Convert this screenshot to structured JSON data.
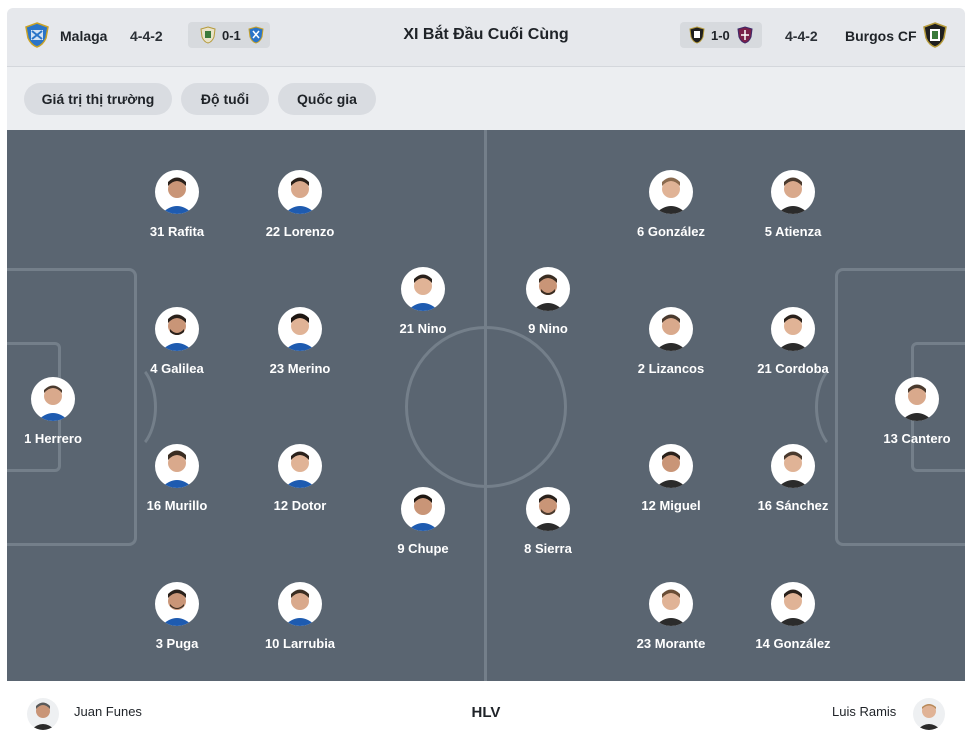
{
  "header": {
    "title": "XI Bắt Đầu Cuối Cùng",
    "home": {
      "name": "Malaga",
      "formation": "4-4-2",
      "last_score": "0-1"
    },
    "away": {
      "name": "Burgos CF",
      "formation": "4-4-2",
      "last_score": "1-0"
    }
  },
  "filters": [
    "Giá trị thị trường",
    "Độ tuổi",
    "Quốc gia"
  ],
  "home_players": [
    {
      "label": "1 Herrero"
    },
    {
      "label": "31 Rafita"
    },
    {
      "label": "4 Galilea"
    },
    {
      "label": "16 Murillo"
    },
    {
      "label": "3 Puga"
    },
    {
      "label": "22 Lorenzo"
    },
    {
      "label": "23 Merino"
    },
    {
      "label": "12 Dotor"
    },
    {
      "label": "10 Larrubia"
    },
    {
      "label": "21 Nino"
    },
    {
      "label": "9 Chupe"
    }
  ],
  "away_players": [
    {
      "label": "9 Nino"
    },
    {
      "label": "8 Sierra"
    },
    {
      "label": "6 González"
    },
    {
      "label": "2 Lizancos"
    },
    {
      "label": "12 Miguel"
    },
    {
      "label": "23 Morante"
    },
    {
      "label": "5 Atienza"
    },
    {
      "label": "21 Cordoba"
    },
    {
      "label": "16 Sánchez"
    },
    {
      "label": "14 González"
    },
    {
      "label": "13 Cantero"
    }
  ],
  "coaches": {
    "label": "HLV",
    "home": "Juan Funes",
    "away": "Luis Ramis"
  },
  "colors": {
    "pitch": "#5a6571",
    "pitch_lines": "#747f8a",
    "header_bg": "#e6e8ec"
  }
}
